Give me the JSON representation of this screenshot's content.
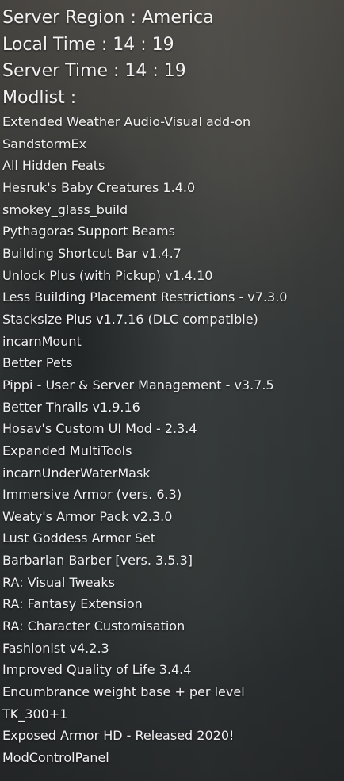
{
  "server": {
    "region_label": "Server Region",
    "region_value": "America",
    "local_time_label": "Local Time",
    "local_time_value": "14 : 19",
    "server_time_label": "Server Time",
    "server_time_value": "14 : 19",
    "modlist_label": "Modlist :"
  },
  "mods": [
    "Extended Weather Audio-Visual add-on",
    "SandstormEx",
    "All Hidden Feats",
    "Hesruk's Baby Creatures 1.4.0",
    "smokey_glass_build",
    "Pythagoras  Support Beams",
    "Building Shortcut Bar v1.4.7",
    "Unlock Plus (with Pickup) v1.4.10",
    "Less Building Placement Restrictions - v7.3.0",
    "Stacksize Plus v1.7.16 (DLC compatible)",
    "incarnMount",
    "Better Pets",
    "Pippi - User & Server Management - v3.7.5",
    "Better Thralls v1.9.16",
    "Hosav's Custom UI Mod - 2.3.4",
    "Expanded MultiTools",
    "incarnUnderWaterMask",
    "Immersive Armor (vers. 6.3)",
    "Weaty's Armor Pack v2.3.0",
    "Lust Goddess Armor Set",
    "Barbarian Barber [vers. 3.5.3]",
    "RA: Visual Tweaks",
    "RA: Fantasy Extension",
    "RA: Character Customisation",
    "Fashionist v4.2.3",
    "Improved Quality of Life 3.4.4",
    "Encumbrance weight base + per level",
    "TK_300+1",
    "Exposed Armor HD - Released 2020!",
    "ModControlPanel"
  ]
}
